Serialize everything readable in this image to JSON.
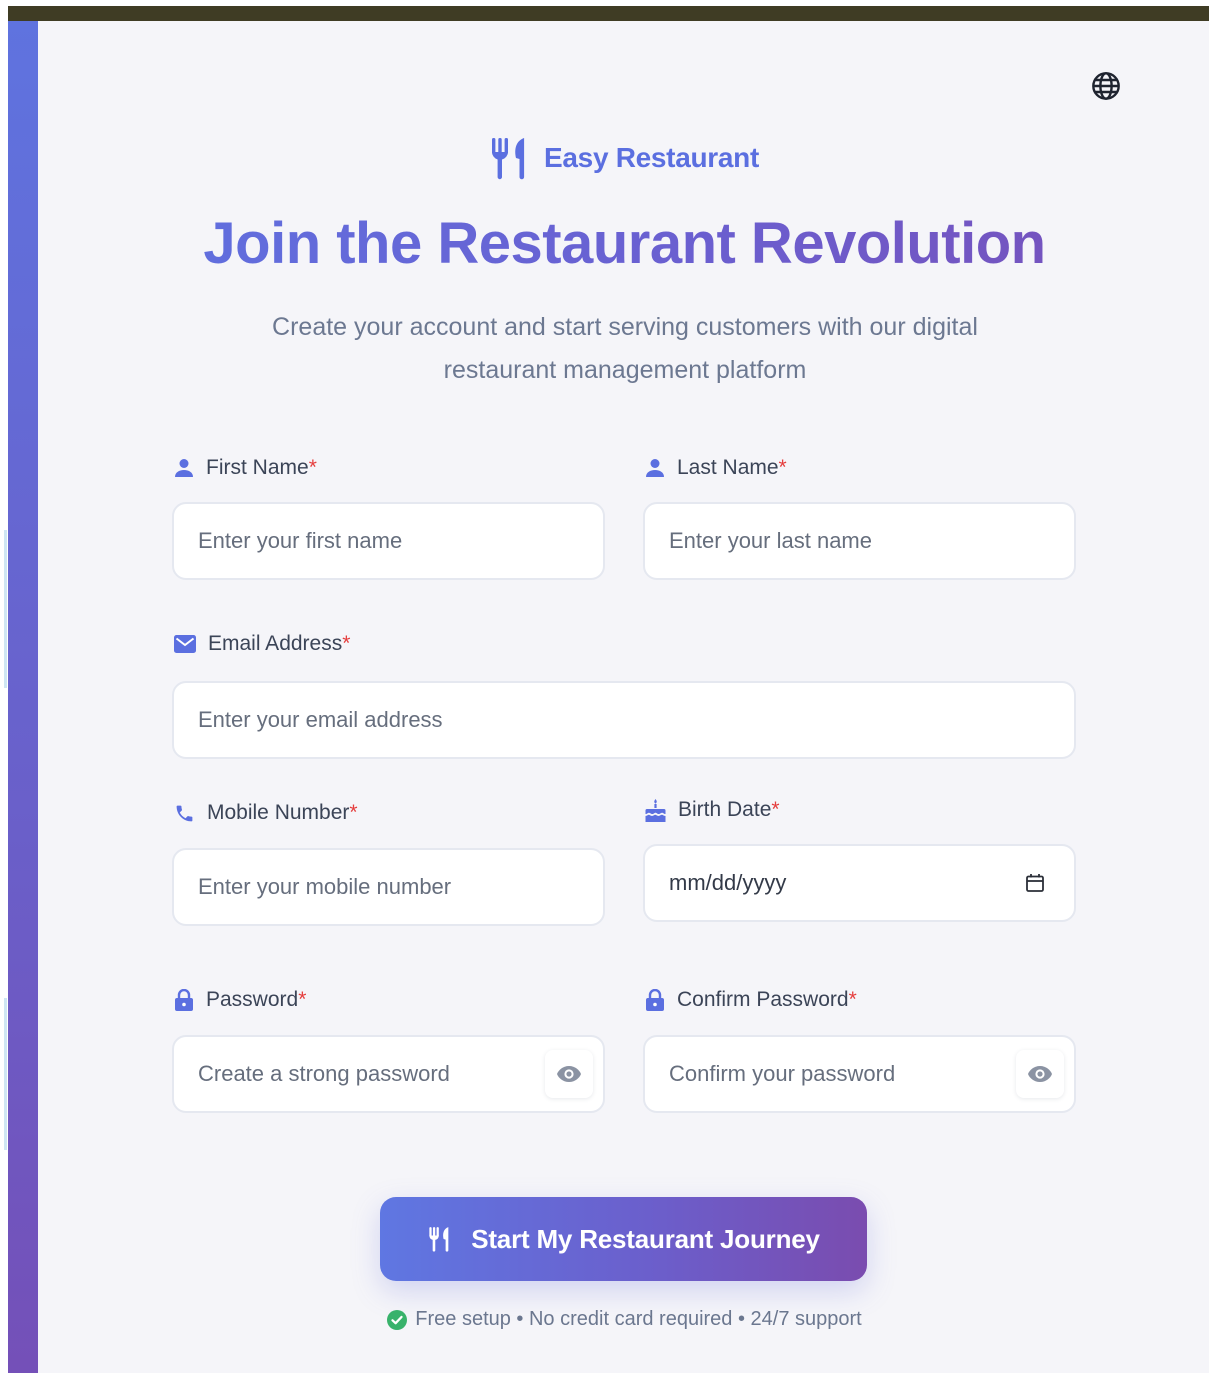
{
  "header": {
    "language_icon": "globe-icon",
    "brand_icon": "utensils-icon",
    "brand_name": "Easy Restaurant",
    "title": "Join the Restaurant Revolution",
    "subtitle": "Create your account and start serving customers with our digital restaurant management platform"
  },
  "form": {
    "required_mark": "*",
    "first_name": {
      "label": "First Name",
      "icon": "user-icon",
      "placeholder": "Enter your first name"
    },
    "last_name": {
      "label": "Last Name",
      "icon": "user-icon",
      "placeholder": "Enter your last name"
    },
    "email": {
      "label": "Email Address",
      "icon": "envelope-icon",
      "placeholder": "Enter your email address"
    },
    "mobile": {
      "label": "Mobile Number",
      "icon": "phone-icon",
      "placeholder": "Enter your mobile number"
    },
    "birth_date": {
      "label": "Birth Date",
      "icon": "birthday-cake-icon",
      "value": "mm/dd/yyyy",
      "picker_icon": "calendar-icon"
    },
    "password": {
      "label": "Password",
      "icon": "lock-icon",
      "placeholder": "Create a strong password",
      "toggle_icon": "eye-icon"
    },
    "confirm_password": {
      "label": "Confirm Password",
      "icon": "lock-icon",
      "placeholder": "Confirm your password",
      "toggle_icon": "eye-icon"
    }
  },
  "submit": {
    "label": "Start My Restaurant Journey",
    "icon": "utensils-icon"
  },
  "footnote": {
    "icon": "check-circle-icon",
    "text": "Free setup • No credit card required • 24/7 support"
  },
  "colors": {
    "accent": "#5b6fe0",
    "accent_end": "#7a4eb6",
    "required": "#e53e3e",
    "success": "#38b26b",
    "top_bar": "#3f3c24"
  }
}
